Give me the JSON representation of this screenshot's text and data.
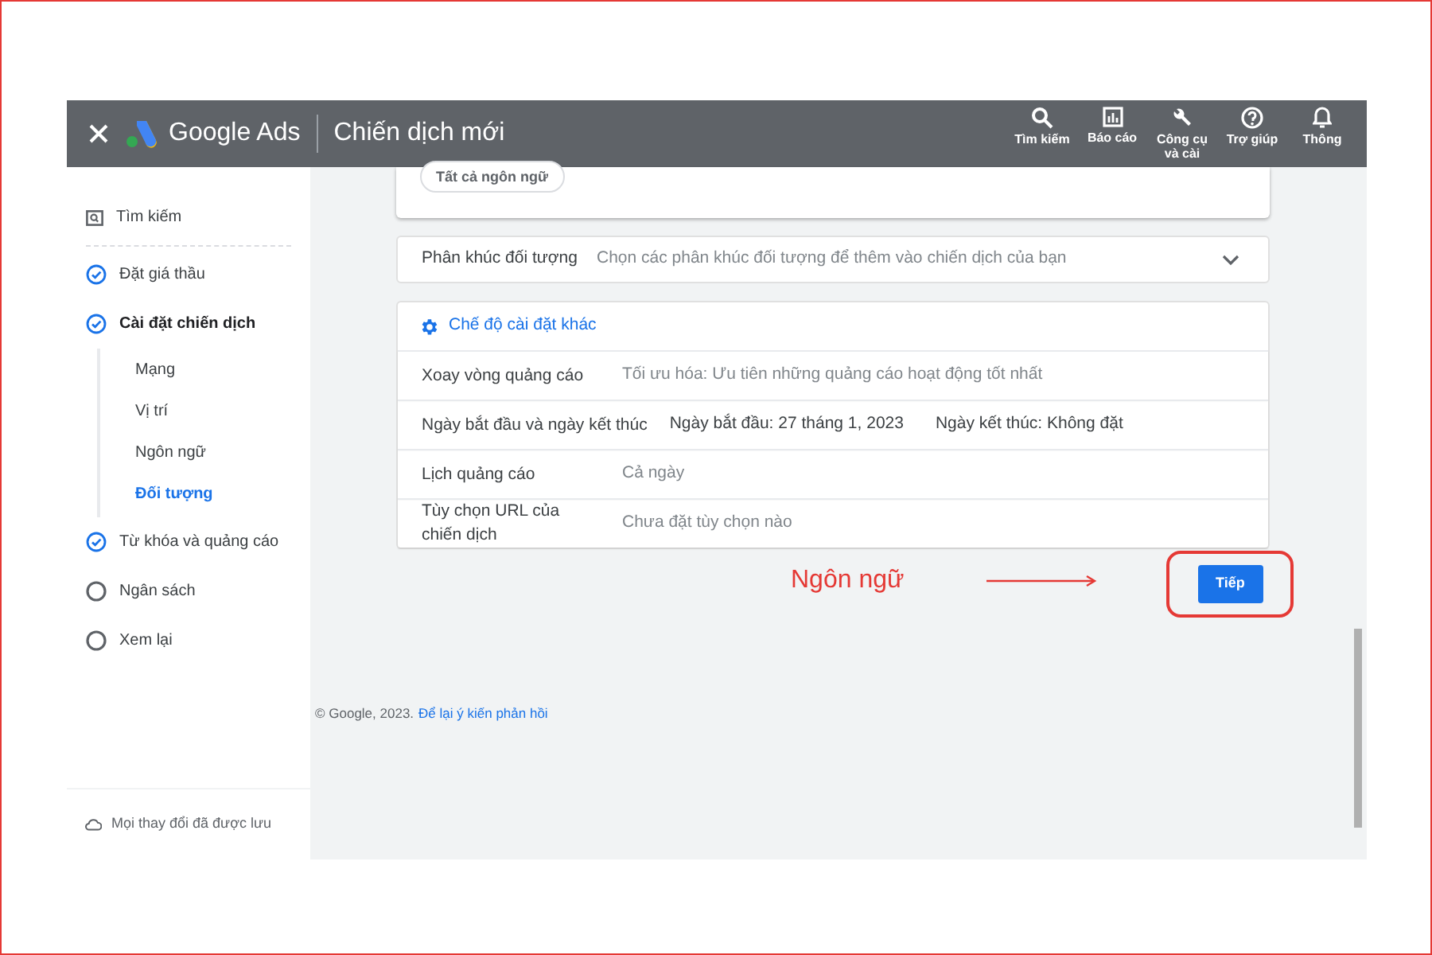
{
  "header": {
    "brand": "Google Ads",
    "title": "Chiến dịch mới",
    "tools": [
      {
        "kind": "search",
        "label": "Tìm kiếm"
      },
      {
        "kind": "chart",
        "label": "Báo cáo"
      },
      {
        "kind": "wrench",
        "label": "Công cụ và cài"
      },
      {
        "kind": "help",
        "label": "Trợ giúp"
      },
      {
        "kind": "bell",
        "label": "Thông"
      }
    ]
  },
  "sidebar": {
    "items": [
      {
        "kind": "type",
        "label": "Tìm kiếm",
        "selected": false
      },
      {
        "kind": "step",
        "label": "Đặt giá thầu",
        "checked": true,
        "selected": false
      },
      {
        "kind": "step",
        "label": "Cài đặt chiến dịch",
        "checked": true,
        "selected": true,
        "children": [
          {
            "label": "Mạng",
            "selected": false
          },
          {
            "label": "Vị trí",
            "selected": false
          },
          {
            "label": "Ngôn ngữ",
            "selected": false
          },
          {
            "label": "Đối tượng",
            "selected": true
          }
        ]
      },
      {
        "kind": "step",
        "label": "Từ khóa và quảng cáo",
        "checked": true,
        "selected": false
      },
      {
        "kind": "step",
        "label": "Ngân sách",
        "checked": false,
        "selected": false
      },
      {
        "kind": "step",
        "label": "Xem lại",
        "checked": false,
        "selected": false
      }
    ],
    "saved_status": "Mọi thay đổi đã được lưu"
  },
  "language_chip": "Tất cả ngôn ngữ",
  "audience": {
    "label": "Phân khúc đối tượng",
    "value": "Chọn các phân khúc đối tượng để thêm vào chiến dịch của bạn",
    "expanded": false
  },
  "more_settings": {
    "title": "Chế độ cài đặt khác",
    "rows": [
      {
        "label": "Xoay vòng quảng cáo",
        "values": [
          "Tối ưu hóa: Ưu tiên những quảng cáo hoạt động tốt nhất"
        ],
        "dark": false
      },
      {
        "label": "Ngày bắt đầu và ngày kết thúc",
        "values": [
          "Ngày bắt đầu: 27 tháng 1, 2023",
          "Ngày kết thúc: Không đặt"
        ],
        "dark": true
      },
      {
        "label": "Lịch quảng cáo",
        "values": [
          "Cả ngày"
        ],
        "dark": false
      },
      {
        "label": "Tùy chọn URL của chiến dịch",
        "values": [
          "Chưa đặt tùy chọn nào"
        ],
        "dark": false
      }
    ]
  },
  "annotation": "Ngôn ngữ",
  "next_button": "Tiếp",
  "footer": {
    "copyright": "© Google, 2023.",
    "link": "Để lại ý kiến phản hồi"
  }
}
